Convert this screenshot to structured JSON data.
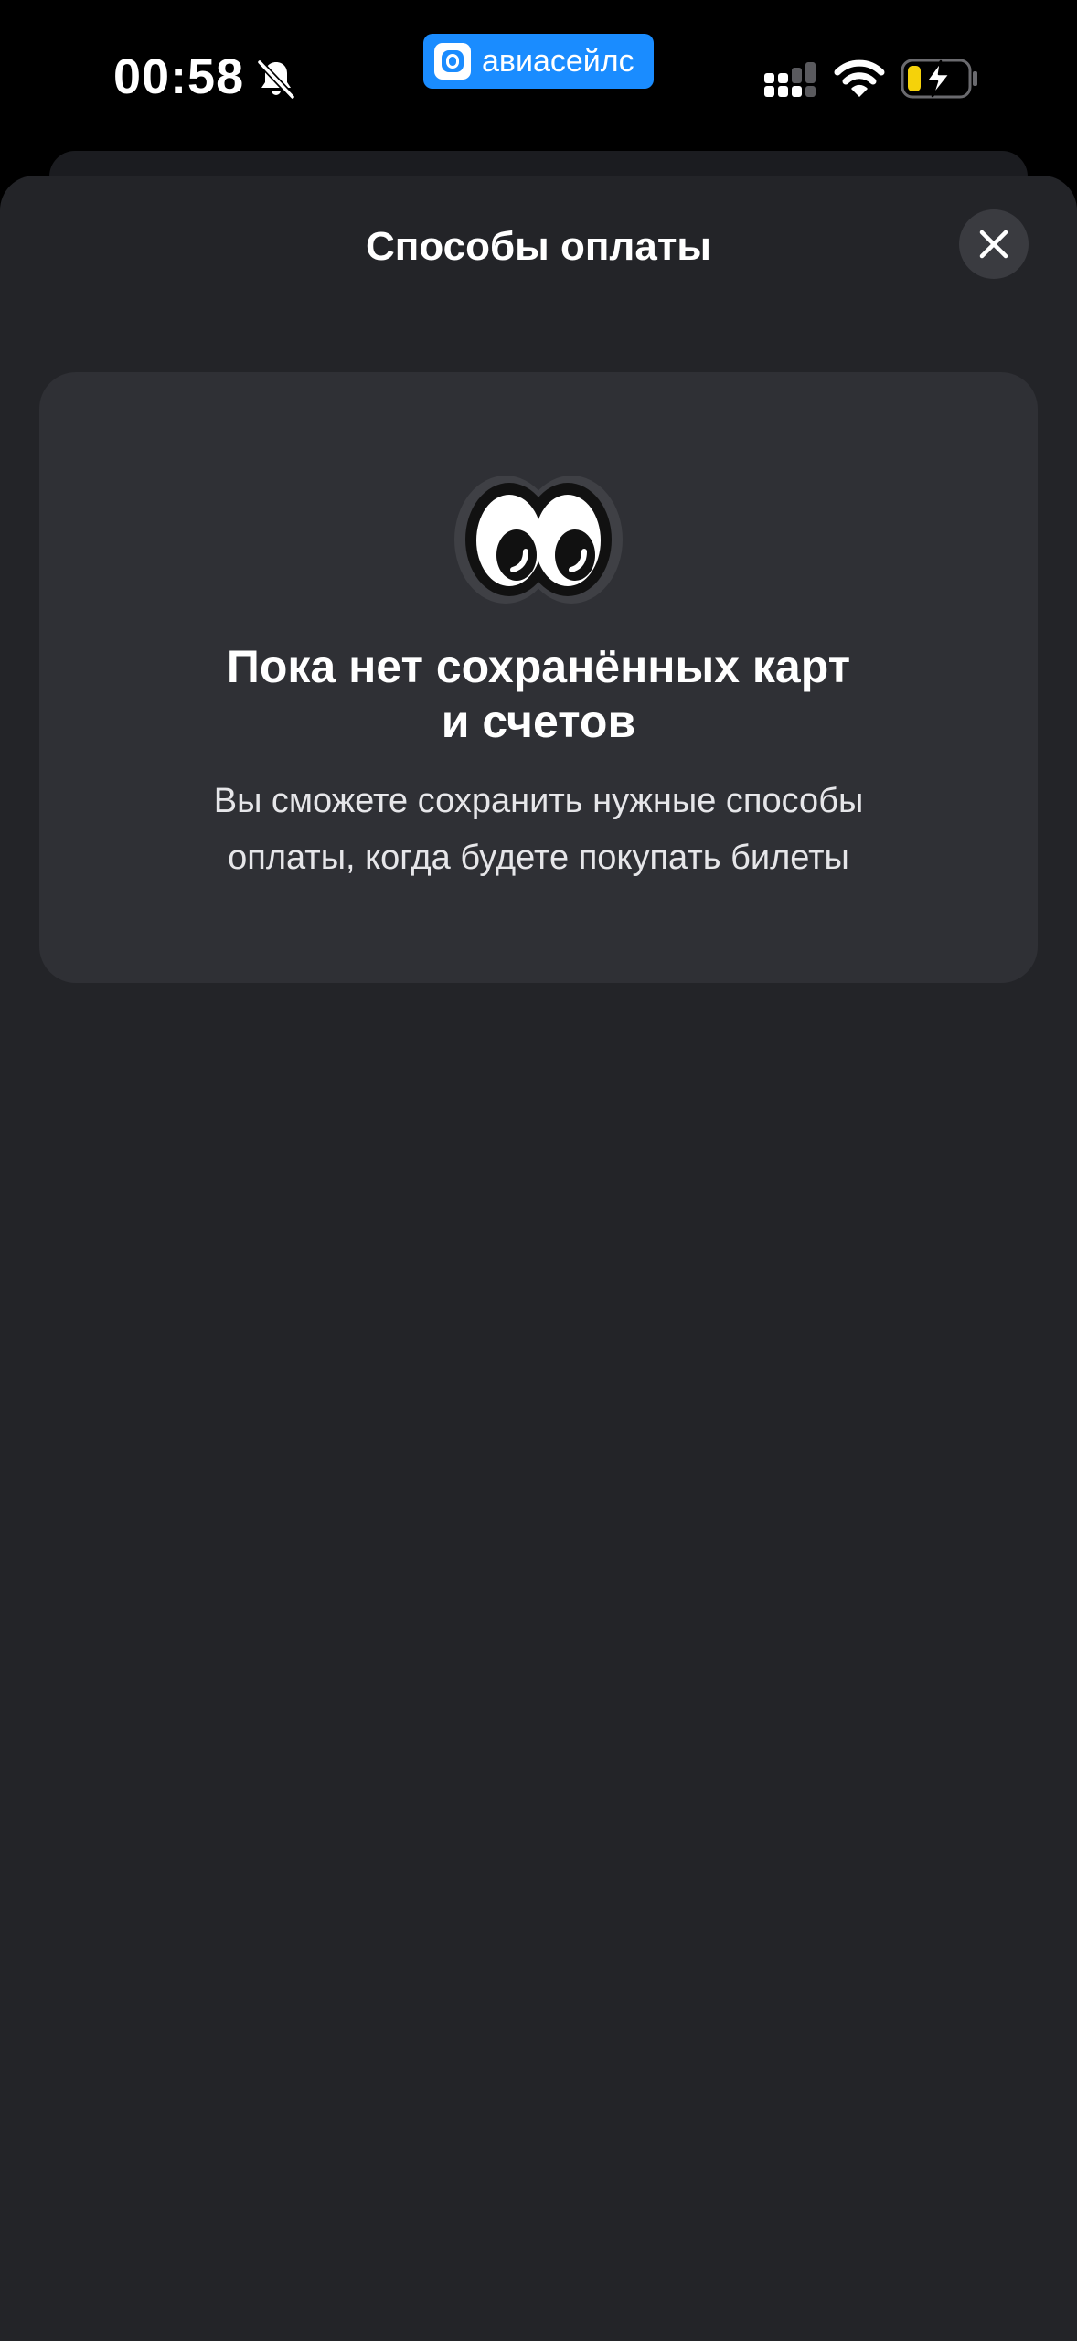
{
  "status_bar": {
    "time": "00:58",
    "app_badge": {
      "label": "авиасейлс",
      "color": "#1a8cff"
    },
    "icons": [
      "bell-slash-icon",
      "signal-icon",
      "wifi-icon",
      "battery-charging-icon"
    ],
    "battery_color": "#f5d20a"
  },
  "sheet": {
    "title": "Способы оплаты",
    "close_icon": "close-icon",
    "background": "#232428"
  },
  "empty_state": {
    "icon": "eyes-icon",
    "title_line1": "Пока нет сохранённых карт",
    "title_line2": "и счетов",
    "description_line1": "Вы сможете сохранить нужные способы",
    "description_line2": "оплаты, когда будете покупать билеты",
    "card_background": "#2f3035"
  }
}
